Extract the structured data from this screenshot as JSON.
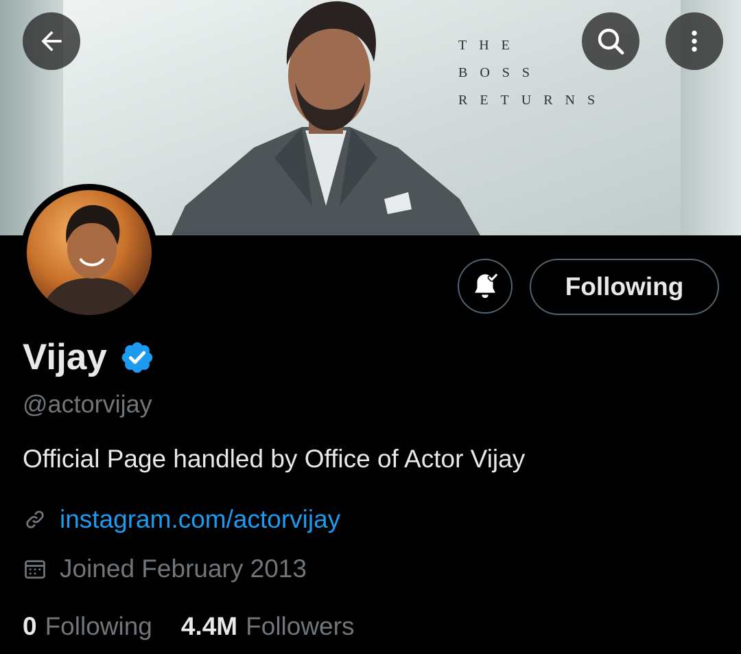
{
  "banner": {
    "tagline": [
      "THE",
      "BOSS",
      "RETURNS"
    ]
  },
  "header": {
    "back_icon": "arrow-left-icon",
    "search_icon": "search-icon",
    "more_icon": "more-vertical-icon"
  },
  "actions": {
    "notifications_icon": "bell-check-icon",
    "follow_label": "Following"
  },
  "profile": {
    "name": "Vijay",
    "verified": true,
    "verified_color": "#1d9bf0",
    "handle": "@actorvijay",
    "bio": "Official Page handled by Office of Actor Vijay",
    "link": "instagram.com/actorvijay",
    "joined": "Joined February 2013"
  },
  "stats": {
    "following_count": "0",
    "following_label": "Following",
    "followers_count": "4.4M",
    "followers_label": "Followers"
  },
  "colors": {
    "background": "#000000",
    "text_primary": "#e7e9ea",
    "text_secondary": "#71767b",
    "accent": "#1d9bf0",
    "border": "#536471"
  }
}
